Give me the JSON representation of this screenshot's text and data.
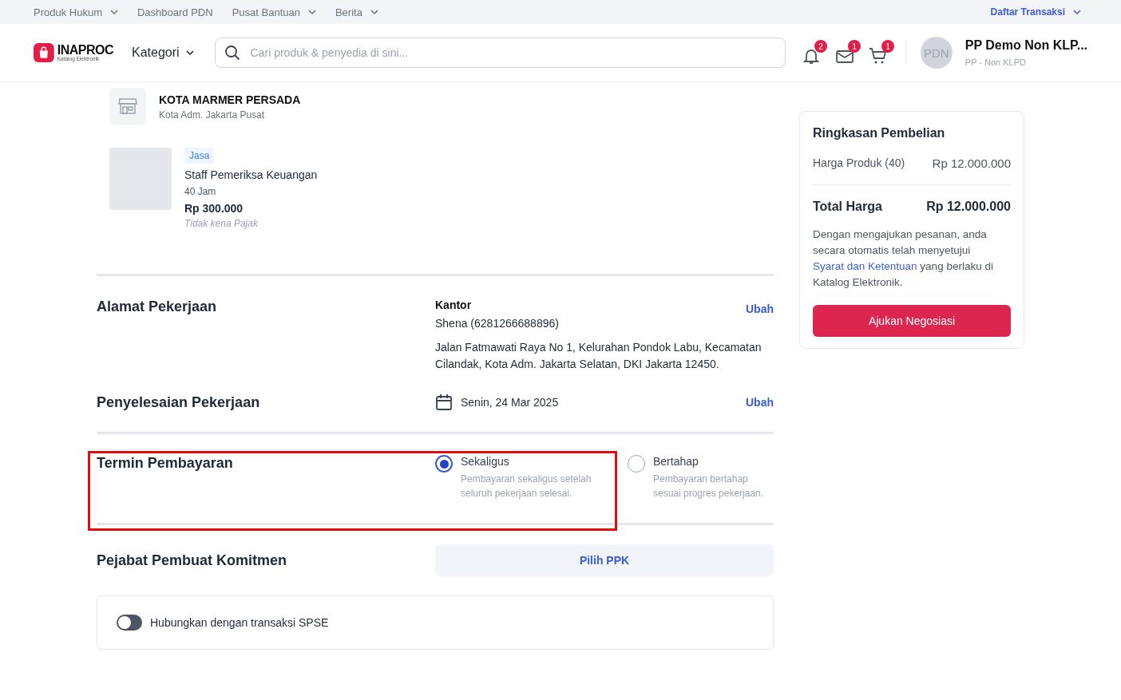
{
  "top_links": [
    {
      "label": "Produk Hukum",
      "dropdown": true
    },
    {
      "label": "Dashboard PDN",
      "dropdown": false
    },
    {
      "label": "Pusat Bantuan",
      "dropdown": true
    },
    {
      "label": "Berita",
      "dropdown": true
    }
  ],
  "transactions_link": {
    "label": "Daftar Transaksi",
    "dropdown": true
  },
  "header": {
    "logo": {
      "name": "INAPROC",
      "tagline": "Katalog Elektronik"
    },
    "category": "Kategori",
    "search": {
      "placeholder": "Cari produk & penyedia di sini..."
    },
    "notifications": [
      {
        "kind": "bell",
        "count": "2"
      },
      {
        "kind": "mail",
        "count": "1"
      },
      {
        "kind": "cart",
        "count": "1"
      }
    ],
    "user": {
      "avatar": "PDN",
      "name": "PP Demo Non KLP...",
      "role": "PP - Non KLPD"
    }
  },
  "seller": {
    "name": "KOTA MARMER PERSADA",
    "location": "Kota Adm. Jakarta Pusat"
  },
  "product": {
    "tag": "Jasa",
    "name": "Staff Pemeriksa Keuangan",
    "quantity": "40 Jam",
    "price": "Rp 300.000",
    "tax_note": "Tidak kena Pajak"
  },
  "work_address": {
    "title": "Alamat Pekerjaan",
    "label": "Kantor",
    "contact": "Shena (6281266688896)",
    "address": "Jalan Fatmawati Raya No 1, Kelurahan Pondok Labu, Kecamatan Cilandak, Kota Adm. Jakarta Selatan, DKI Jakarta 12450.",
    "action": "Ubah"
  },
  "completion": {
    "title": "Penyelesaian Pekerjaan",
    "date": "Senin, 24 Mar 2025",
    "action": "Ubah"
  },
  "payment_terms": {
    "title": "Termin Pembayaran",
    "highlighted": true,
    "options": [
      {
        "label": "Sekaligus",
        "description": "Pembayaran sekaligus setelah seluruh pekerjaan selesai.",
        "selected": true
      },
      {
        "label": "Bertahap",
        "description": "Pembayaran bertahap sesuai progres pekerjaan.",
        "selected": false
      }
    ]
  },
  "commitment_officer": {
    "title": "Pejabat Pembuat Komitmen",
    "button": "Pilih PPK"
  },
  "spse_link": {
    "label": "Hubungkan dengan transaksi SPSE",
    "on": false
  },
  "summary": {
    "title": "Ringkasan Pembelian",
    "rows": [
      {
        "label": "Harga Produk (40)",
        "value": "Rp 12.000.000"
      }
    ],
    "total": {
      "label": "Total Harga",
      "value": "Rp 12.000.000"
    },
    "notice": "Dengan mengajukan pesanan, anda secara otomatis telah menyetujui",
    "terms_link": "Syarat dan Ketentuan",
    "notice_end": "yang berlaku di Katalog Elektronik.",
    "button": "Ajukan Negosiasi"
  }
}
